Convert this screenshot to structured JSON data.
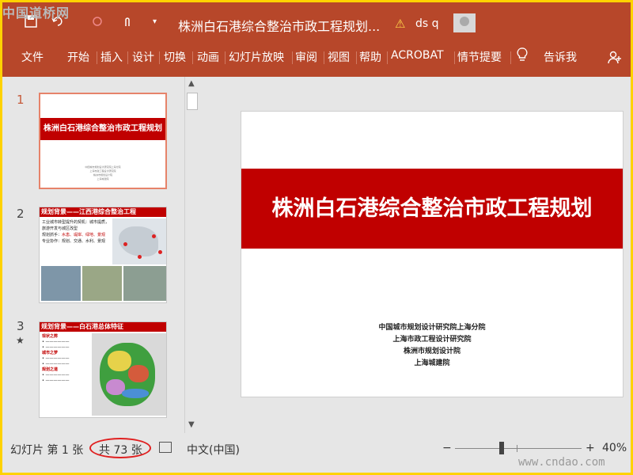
{
  "watermark_top": "中国道桥网",
  "watermark_bottom": "www.cndao.com",
  "titlebar": {
    "doc_title": "株洲白石港综合整治市政工程规划...",
    "user_name": "ds q"
  },
  "ribbon": {
    "tabs": [
      "文件",
      "开始",
      "插入",
      "设计",
      "切换",
      "动画",
      "幻灯片放映",
      "审阅",
      "视图",
      "帮助",
      "ACROBAT",
      "情节提要"
    ],
    "tell_me": "告诉我"
  },
  "thumbnails": [
    {
      "number": "1",
      "title": "株洲白石港综合整治市政工程规划",
      "lines": [
        "中国城市规划设计研究院上海分院",
        "上海市政工程设计研究院",
        "株洲市规划设计院",
        "上海城建院"
      ]
    },
    {
      "number": "2",
      "title": "规划背景——江西港综合整治工程",
      "lines": [
        "工业城市转型提升的契机：城市提质，",
        "旅游开发与城区改型",
        "规划抓手：",
        "专业协作：规划、交通、水利、景观"
      ],
      "highlights": "水患、堤岸、绿地、景观"
    },
    {
      "number": "3",
      "title": "规划背景——白石港总体特征",
      "items": [
        "现状之弊",
        "水质差",
        "城市之梦",
        "规划之道"
      ]
    }
  ],
  "slide": {
    "title": "株洲白石港综合整治市政工程规划",
    "orgs": [
      "中国城市规划设计研究院上海分院",
      "上海市政工程设计研究院",
      "株洲市规划设计院",
      "上海城建院"
    ]
  },
  "statusbar": {
    "slide_pos": "幻灯片 第 1 张",
    "total": "共 73 张",
    "language": "中文(中国)",
    "zoom_minus": "−",
    "zoom_plus": "+",
    "zoom": "40%"
  },
  "colors": {
    "ribbon": "#b7472a",
    "slide_band": "#c00000",
    "annotation_circle": "#e02020"
  }
}
